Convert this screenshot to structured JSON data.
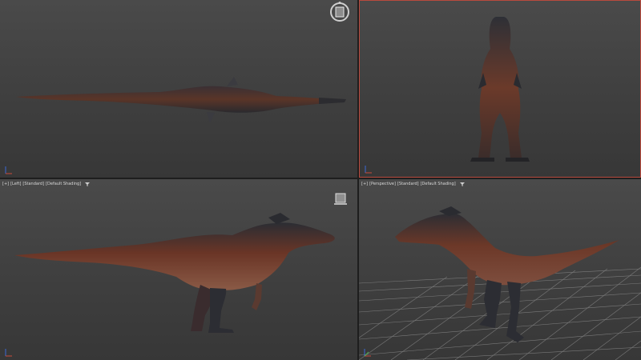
{
  "app": "3ds Max viewport layout",
  "viewports": {
    "top": {
      "label": ""
    },
    "front": {
      "label": ""
    },
    "left": {
      "plus": "[+]",
      "view": "[Left]",
      "mode": "[Standard]",
      "shading": "[Default Shading]"
    },
    "perspective": {
      "plus": "[+]",
      "view": "[Perspective]",
      "mode": "[Standard]",
      "shading": "[Default Shading]"
    }
  },
  "icons": {
    "viewcube": "viewcube-icon",
    "filter": "filter-icon",
    "axis": "axis-tripod-icon"
  },
  "colors": {
    "active_viewport_border": "#b94a3e",
    "viewport_bg": "#444444",
    "grid": "#8a8a8a",
    "model_base": "#5a3126",
    "model_dark": "#222428"
  }
}
